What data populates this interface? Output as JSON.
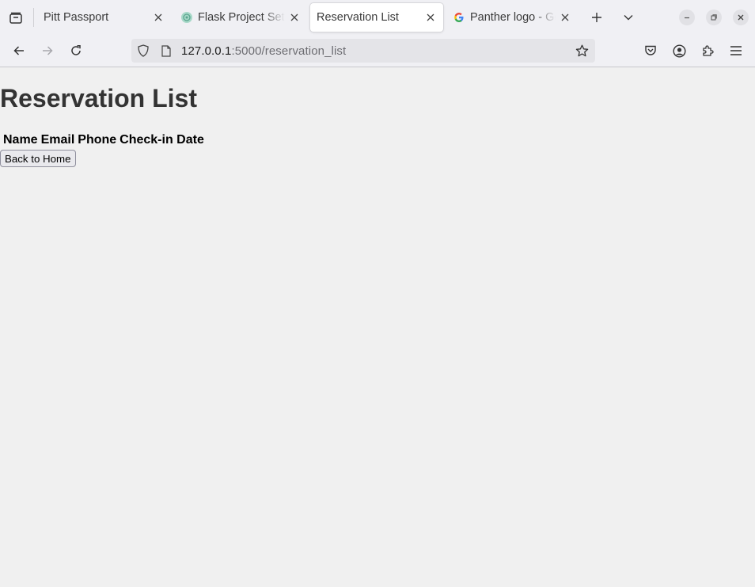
{
  "browser": {
    "tabs": [
      {
        "label": "Pitt Passport",
        "active": false
      },
      {
        "label": "Flask Project Setu",
        "active": false
      },
      {
        "label": "Reservation List",
        "active": true
      },
      {
        "label": "Panther logo - Go",
        "active": false
      }
    ],
    "url": {
      "host": "127.0.0.1",
      "rest": ":5000/reservation_list"
    },
    "accent_color": "#ffffff"
  },
  "page": {
    "title": "Reservation List",
    "table": {
      "headers": [
        "Name",
        "Email",
        "Phone",
        "Check-in Date"
      ],
      "rows": []
    },
    "back_button_label": "Back to Home",
    "text_color": "#333333",
    "background_color": "#f0f0f0"
  }
}
